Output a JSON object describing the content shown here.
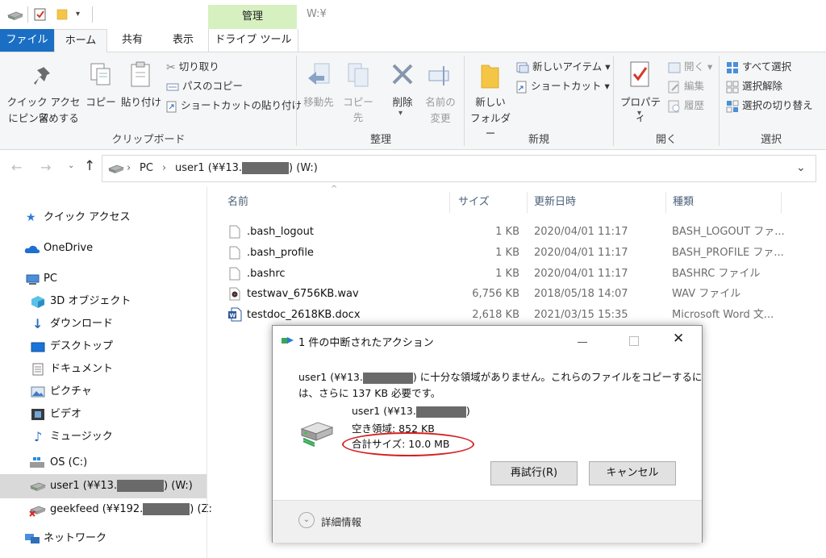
{
  "titlebar": {
    "contextual_tab": "管理",
    "window_title": "W:¥"
  },
  "tabs": [
    "ファイル",
    "ホーム",
    "共有",
    "表示",
    "ドライブ ツール"
  ],
  "ribbon": {
    "clipboard": {
      "pin_line1": "クイック アクセス",
      "pin_line2": "にピン留めする",
      "copy": "コピー",
      "paste": "貼り付け",
      "cut": "切り取り",
      "copy_path": "パスのコピー",
      "paste_shortcut": "ショートカットの貼り付け",
      "label": "クリップボード"
    },
    "organize": {
      "move_to": "移動先",
      "copy_to": "コピー先",
      "delete": "削除",
      "rename_line1": "名前の",
      "rename_line2": "変更",
      "label": "整理"
    },
    "new": {
      "new_folder_line1": "新しい",
      "new_folder_line2": "フォルダー",
      "new_item": "新しいアイテム ▾",
      "shortcut": "ショートカット ▾",
      "label": "新規"
    },
    "open": {
      "properties": "プロパティ",
      "open": "開く ▾",
      "edit": "編集",
      "history": "履歴",
      "label": "開く"
    },
    "select": {
      "select_all": "すべて選択",
      "select_none": "選択解除",
      "invert": "選択の切り替え",
      "label": "選択"
    }
  },
  "address": {
    "seg_pc": "PC",
    "seg_drive_prefix": "user1 (¥¥13.",
    "seg_drive_suffix": ") (W:)"
  },
  "sidebar": {
    "items": [
      {
        "label": "クイック アクセス"
      },
      {
        "label": "OneDrive"
      },
      {
        "label": "PC"
      },
      {
        "label": "3D オブジェクト"
      },
      {
        "label": "ダウンロード"
      },
      {
        "label": "デスクトップ"
      },
      {
        "label": "ドキュメント"
      },
      {
        "label": "ピクチャ"
      },
      {
        "label": "ビデオ"
      },
      {
        "label": "ミュージック"
      },
      {
        "label": "OS (C:)"
      },
      {
        "label_prefix": "user1 (¥¥13.",
        "label_suffix": ") (W:)"
      },
      {
        "label_prefix": "geekfeed (¥¥192.",
        "label_suffix": ") (Z:"
      },
      {
        "label": "ネットワーク"
      }
    ]
  },
  "filelist": {
    "columns": [
      "名前",
      "サイズ",
      "更新日時",
      "種類"
    ],
    "rows": [
      {
        "name": ".bash_logout",
        "size": "1 KB",
        "date": "2020/04/01 11:17",
        "type": "BASH_LOGOUT ファ..."
      },
      {
        "name": ".bash_profile",
        "size": "1 KB",
        "date": "2020/04/01 11:17",
        "type": "BASH_PROFILE ファ..."
      },
      {
        "name": ".bashrc",
        "size": "1 KB",
        "date": "2020/04/01 11:17",
        "type": "BASHRC ファイル"
      },
      {
        "name": "testwav_6756KB.wav",
        "size": "6,756 KB",
        "date": "2018/05/18 14:07",
        "type": "WAV ファイル"
      },
      {
        "name": "testdoc_2618KB.docx",
        "size": "2,618 KB",
        "date": "2021/03/15 15:35",
        "type": "Microsoft Word 文..."
      }
    ]
  },
  "dialog": {
    "title": "1 件の中断されたアクション",
    "msg_prefix": "user1 (¥¥13.",
    "msg_suffix": ") に十分な領域がありません。これらのファイルをコピーするに",
    "msg_line2": "は、さらに 137 KB 必要です。",
    "drive_prefix": "user1 (¥¥13.",
    "drive_suffix": ")",
    "free_space": "空き領域: 852 KB",
    "total_size": "合計サイズ: 10.0 MB",
    "retry": "再試行(R)",
    "cancel": "キャンセル",
    "details": "詳細情報"
  },
  "colors": {
    "file_tab": "#1a6fc4",
    "manage_tab": "#d6f0c0",
    "highlight_circle": "#d42020"
  }
}
